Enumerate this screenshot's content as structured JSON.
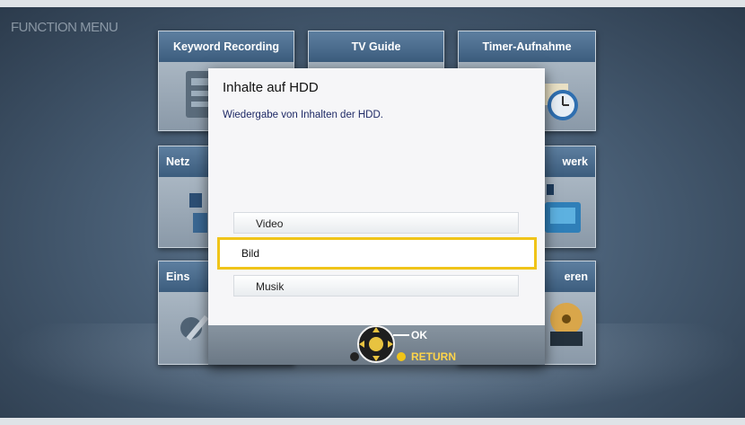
{
  "menu": {
    "title": "FUNCTION MENU",
    "tiles": [
      {
        "label": "Keyword Recording"
      },
      {
        "label": "TV Guide"
      },
      {
        "label": "Timer-Aufnahme"
      },
      {
        "label": "Netz"
      },
      {
        "label": "werk"
      },
      {
        "label": "Eins"
      },
      {
        "label": "eren"
      }
    ]
  },
  "dialog": {
    "title": "Inhalte auf HDD",
    "description": "Wiedergabe von Inhalten der HDD.",
    "options": [
      {
        "label": "Video",
        "selected": false
      },
      {
        "label": "Bild",
        "selected": true
      },
      {
        "label": "Musik",
        "selected": false
      }
    ],
    "footer": {
      "ok_label": "OK",
      "return_label": "RETURN"
    }
  },
  "colors": {
    "selection_border": "#f0c419",
    "return_color": "#ffd54a"
  }
}
